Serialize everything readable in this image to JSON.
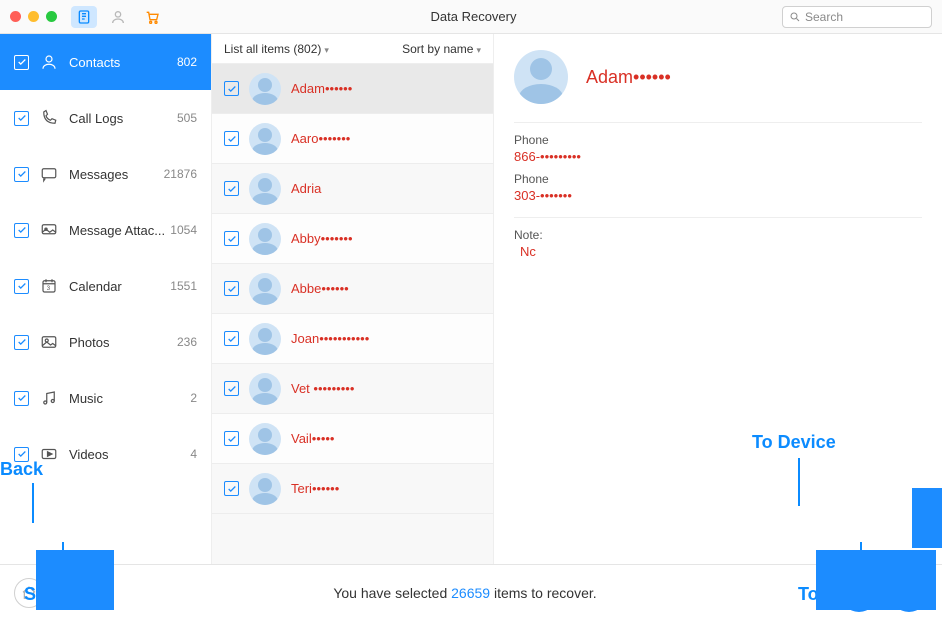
{
  "header": {
    "title": "Data Recovery",
    "search_placeholder": "Search"
  },
  "sidebar": {
    "items": [
      {
        "label": "Contacts",
        "count": "802",
        "selected": true,
        "icon": "person"
      },
      {
        "label": "Call Logs",
        "count": "505",
        "selected": false,
        "icon": "phone"
      },
      {
        "label": "Messages",
        "count": "21876",
        "selected": false,
        "icon": "message"
      },
      {
        "label": "Message Attac...",
        "count": "1054",
        "selected": false,
        "icon": "attach"
      },
      {
        "label": "Calendar",
        "count": "1551",
        "selected": false,
        "icon": "calendar"
      },
      {
        "label": "Photos",
        "count": "236",
        "selected": false,
        "icon": "photo"
      },
      {
        "label": "Music",
        "count": "2",
        "selected": false,
        "icon": "music"
      },
      {
        "label": "Videos",
        "count": "4",
        "selected": false,
        "icon": "video"
      }
    ]
  },
  "list": {
    "header_left": "List all items (802)",
    "header_right": "Sort by name",
    "items": [
      {
        "name": "Adam••••••",
        "selected": true,
        "red": true
      },
      {
        "name": "Aaro•••••••",
        "selected": false,
        "red": true
      },
      {
        "name": "Adria",
        "selected": false,
        "red": true
      },
      {
        "name": "Abby•••••••",
        "selected": false,
        "red": true
      },
      {
        "name": "Abbe••••••",
        "selected": false,
        "red": true
      },
      {
        "name": "Joan•••••••••••",
        "selected": false,
        "red": true
      },
      {
        "name": "Vet •••••••••",
        "selected": false,
        "red": true
      },
      {
        "name": "Vail•••••",
        "selected": false,
        "red": true
      },
      {
        "name": "Teri••••••",
        "selected": false,
        "red": true
      }
    ]
  },
  "detail": {
    "name": "Adam••••••",
    "phones": [
      {
        "label": "Phone",
        "value": "866-•••••••••"
      },
      {
        "label": "Phone",
        "value": "303-•••••••"
      }
    ],
    "note_label": "Note:",
    "note_value": "Nc"
  },
  "bottom": {
    "status_prefix": "You have selected ",
    "status_count": "26659",
    "status_suffix": " items to recover."
  },
  "callouts": {
    "back": "Back",
    "settings": "Settings",
    "to_device": "To Device",
    "to_computer": "To Computer"
  }
}
